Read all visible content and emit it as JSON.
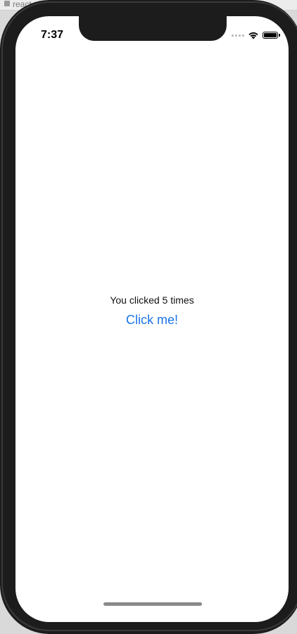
{
  "browser": {
    "tab_text": "react-native"
  },
  "status_bar": {
    "time": "7:37"
  },
  "app": {
    "counter_text": "You clicked 5 times",
    "button_label": "Click me!"
  },
  "colors": {
    "accent": "#1a73e8",
    "frame": "#1c1c1c"
  },
  "icons": [
    "wifi-icon",
    "battery-icon",
    "signal-icon",
    "lock-icon"
  ]
}
